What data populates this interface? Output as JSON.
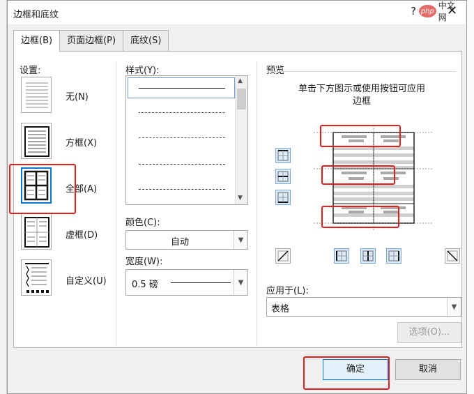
{
  "dialog": {
    "title": "边框和底纹",
    "help": "?",
    "close": "✕",
    "watermark_php": "php",
    "watermark_cn": "中文网"
  },
  "tabs": [
    {
      "label": "边框(B)"
    },
    {
      "label": "页面边框(P)"
    },
    {
      "label": "底纹(S)"
    }
  ],
  "settings": {
    "title": "设置:",
    "items": [
      {
        "label": "无(N)"
      },
      {
        "label": "方框(X)"
      },
      {
        "label": "全部(A)"
      },
      {
        "label": "虚框(D)"
      },
      {
        "label": "自定义(U)"
      }
    ]
  },
  "style": {
    "title": "样式(Y):"
  },
  "color": {
    "title": "颜色(C):",
    "value": "自动"
  },
  "width": {
    "title": "宽度(W):",
    "value": "0.5 磅"
  },
  "preview": {
    "title": "预览",
    "hint_line1": "单击下方图示或使用按钮可应用",
    "hint_line2": "边框"
  },
  "apply_to": {
    "title": "应用于(L):",
    "value": "表格"
  },
  "buttons": {
    "options": "选项(O)...",
    "ok": "确定",
    "cancel": "取消"
  },
  "colors": {
    "highlight": "#e02020",
    "selection_border": "#0078d7"
  }
}
